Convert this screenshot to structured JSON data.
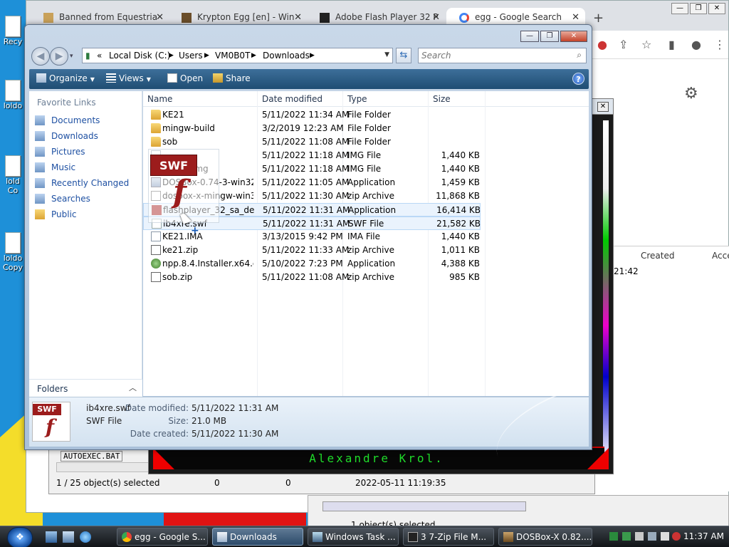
{
  "desktop": {
    "icons": [
      {
        "label": "Recy"
      },
      {
        "label": "loldo"
      },
      {
        "label": "lold"
      },
      {
        "label": "Co"
      },
      {
        "label": "loldo"
      },
      {
        "label": "Copy"
      }
    ]
  },
  "chrome": {
    "tabs": [
      {
        "label": "Banned from Equestria",
        "icon": "horse-icon",
        "active": false
      },
      {
        "label": "Krypton Egg [en] - Win",
        "icon": "chess-icon",
        "active": false
      },
      {
        "label": "Adobe Flash Player 32 P",
        "icon": "museum-icon",
        "active": false
      },
      {
        "label": "egg - Google Search",
        "icon": "google-icon",
        "active": true
      }
    ],
    "new_tab": "+"
  },
  "dosbox": {
    "credit_text": "Alexandre Krol."
  },
  "sevenzip": {
    "tree_item": "AUTOEXEC.BAT",
    "status": "1 / 25 object(s) selected",
    "col2": "0",
    "col3": "0",
    "modified": "2022-05-11 11:19:35"
  },
  "taskmanager": {
    "status": "1 object(s) selected",
    "columns": [
      "Created",
      "Acce"
    ],
    "cell": "21:42"
  },
  "explorer": {
    "address": {
      "segments": [
        "Local Disk (C:)",
        "Users",
        "VM0B0T",
        "Downloads"
      ]
    },
    "search_placeholder": "Search",
    "commands": {
      "organize": "Organize",
      "views": "Views",
      "open": "Open",
      "share": "Share"
    },
    "nav": {
      "title": "Favorite Links",
      "links": [
        "Documents",
        "Downloads",
        "Pictures",
        "Music",
        "Recently Changed",
        "Searches",
        "Public"
      ],
      "folders": "Folders"
    },
    "columns": {
      "name": "Name",
      "date": "Date modified",
      "type": "Type",
      "size": "Size"
    },
    "files": [
      {
        "name": "KE21",
        "date": "5/11/2022 11:34 AM",
        "type": "File Folder",
        "size": "",
        "icon": "folder-icon"
      },
      {
        "name": "mingw-build",
        "date": "3/2/2019 12:23 AM",
        "type": "File Folder",
        "size": "",
        "icon": "folder-icon"
      },
      {
        "name": "sob",
        "date": "5/11/2022 11:08 AM",
        "type": "File Folder",
        "size": "",
        "icon": "folder-icon"
      },
      {
        "name": "",
        "date": "5/11/2022 11:18 AM",
        "type": "IMG File",
        "size": "1,440 KB",
        "icon": "img-icon"
      },
      {
        "name": "Floppy.img",
        "date": "5/11/2022 11:18 AM",
        "type": "IMG File",
        "size": "1,440 KB",
        "icon": "img-icon"
      },
      {
        "name": "DOSBox-0.74-3-win32-i...",
        "date": "5/11/2022 11:05 AM",
        "type": "Application",
        "size": "1,459 KB",
        "icon": "app-icon"
      },
      {
        "name": "dosbox-x-mingw-win3...",
        "date": "5/11/2022 11:30 AM",
        "type": "zip Archive",
        "size": "11,868 KB",
        "icon": "zip-icon"
      },
      {
        "name": "flashplayer_32_sa_deb...",
        "date": "5/11/2022 11:31 AM",
        "type": "Application",
        "size": "16,414 KB",
        "icon": "flash-icon"
      },
      {
        "name": "ib4xre.swf",
        "date": "5/11/2022 11:31 AM",
        "type": "SWF File",
        "size": "21,582 KB",
        "icon": "swf-icon"
      },
      {
        "name": "KE21.IMA",
        "date": "3/13/2015 9:42 PM",
        "type": "IMA File",
        "size": "1,440 KB",
        "icon": "img-icon"
      },
      {
        "name": "ke21.zip",
        "date": "5/11/2022 11:33 AM",
        "type": "zip Archive",
        "size": "1,011 KB",
        "icon": "zip-icon"
      },
      {
        "name": "npp.8.4.Installer.x64.exe",
        "date": "5/10/2022 7:23 PM",
        "type": "Application",
        "size": "4,388 KB",
        "icon": "gear-icon"
      },
      {
        "name": "sob.zip",
        "date": "5/11/2022 11:08 AM",
        "type": "zip Archive",
        "size": "985 KB",
        "icon": "zip-icon"
      }
    ],
    "drag": {
      "badge": "SWF",
      "glyph": "f"
    },
    "details": {
      "filename": "ib4xre.swf",
      "filetype": "SWF File",
      "modified_label": "Date modified:",
      "modified_value": "5/11/2022 11:31 AM",
      "size_label": "Size:",
      "size_value": "21.0 MB",
      "created_label": "Date created:",
      "created_value": "5/11/2022 11:30 AM",
      "badge": "SWF",
      "glyph": "f"
    }
  },
  "taskbar": {
    "buttons": [
      {
        "label": "egg - Google S...",
        "icon": "chrome-icon"
      },
      {
        "label": "Downloads",
        "icon": "explorer-icon",
        "active": true
      },
      {
        "label": "Windows Task ...",
        "icon": "taskmgr-icon"
      },
      {
        "label": "3 7-Zip File M...",
        "icon": "sevenzip-icon"
      },
      {
        "label": "DOSBox-X 0.82....",
        "icon": "dosbox-icon"
      }
    ],
    "clock": "11:37 AM"
  }
}
